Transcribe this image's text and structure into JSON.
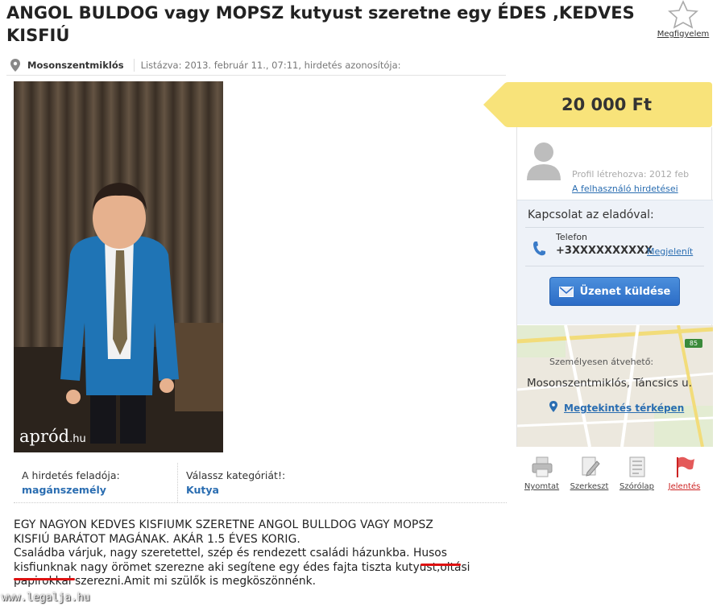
{
  "header": {
    "title": "ANGOL BULDOG vagy MOPSZ kutyust szeretne egy ÉDES ,KEDVES KISFIÚ",
    "favorite_label": "Megfigyelem"
  },
  "location_bar": {
    "city": "Mosonszentmiklós",
    "listed_text": "Listázva: 2013. február 11., 07:11, hirdetés azonosítója:"
  },
  "photo": {
    "watermark_main": "apród",
    "watermark_suffix": ".hu"
  },
  "info": {
    "advertiser_label": "A hirdetés feladója:",
    "advertiser_value": "magánszemély",
    "category_label": "Válassz kategóriát!:",
    "category_value": "Kutya"
  },
  "description": {
    "line1": "EGY NAGYON KEDVES KISFIUMK SZERETNE ANGOL BULLDOG VAGY MOPSZ",
    "line2": "KISFIÚ BARÁTOT MAGÁNAK. AKÁR 1.5 ÉVES KORIG.",
    "line3_a": "Családba várjuk, nagy szeretettel, szép és rendezett családi házunkba. ",
    "line3_b": "Husos",
    "line4_a": "kisfiunknak",
    "line4_b": " nagy örömet szerezne aki segítene egy édes fajta tiszta kutyust,oltási",
    "line5": "papirokkal szerezni.Amit mi szülők is megköszönnénk."
  },
  "site_watermark": "www.legalja.hu",
  "price": "20 000 Ft",
  "profile": {
    "created": "Profil létrehozva: 2012 feb",
    "ads_link": "A felhasználó hirdetései"
  },
  "contact": {
    "title": "Kapcsolat az eladóval:",
    "phone_label": "Telefon",
    "phone_number": "+3XXXXXXXXXX",
    "show_link": "Megjelenít",
    "message_button": "Üzenet küldése"
  },
  "map": {
    "pickup_label": "Személyesen átvehető:",
    "address": "Mosonszentmiklós, Táncsics u.",
    "map_link": "Megtekintés térképen",
    "road_badge": "85"
  },
  "actions": [
    {
      "label": "Nyomtat",
      "icon": "printer-icon"
    },
    {
      "label": "Szerkeszt",
      "icon": "edit-icon"
    },
    {
      "label": "Szórólap",
      "icon": "flyer-icon"
    },
    {
      "label": "Jelentés",
      "icon": "report-flag-icon"
    }
  ],
  "colors": {
    "link_blue": "#2a6db1",
    "price_yellow": "#f8e37a",
    "button_blue": "#2c6cc6",
    "report_red": "#c22222",
    "annotation_red": "#dd1111"
  }
}
